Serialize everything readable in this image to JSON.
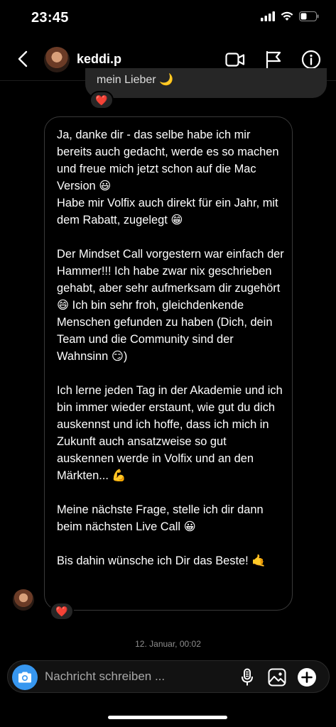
{
  "status_bar": {
    "time": "23:45"
  },
  "header": {
    "username": "keddi.p"
  },
  "previous_message": {
    "text": "mein Lieber 🌙",
    "reaction": "❤️"
  },
  "message": {
    "text": "Ja, danke dir - das selbe habe ich mir bereits auch gedacht, werde es so machen und freue mich jetzt schon auf die Mac Version 😃\nHabe mir Volfix auch direkt für ein Jahr, mit dem Rabatt, zugelegt 😁\n\nDer Mindset Call vorgestern war einfach der Hammer!!! Ich habe zwar nix geschrieben gehabt, aber sehr aufmerksam dir zugehört 😄 Ich bin sehr froh, gleichdenkende Menschen gefunden zu haben (Dich, dein Team und die Community sind der Wahnsinn 😏)\n\nIch lerne jeden Tag in der Akademie und ich bin immer wieder erstaunt, wie gut du dich auskennst und ich hoffe, dass ich mich in Zukunft auch ansatzweise so gut auskennen werde in Volfix und an den Märkten... 💪\n\nMeine nächste Frage, stelle ich dir dann beim nächsten Live Call 😀\n\nBis dahin wünsche ich Dir das Beste! 🤙",
    "reaction": "❤️"
  },
  "timestamp": "12. Januar, 00:02",
  "composer": {
    "placeholder": "Nachricht schreiben ..."
  },
  "colors": {
    "accent": "#3797f0",
    "heart": "#ed4956",
    "bubble_border": "#3a3a3a"
  }
}
